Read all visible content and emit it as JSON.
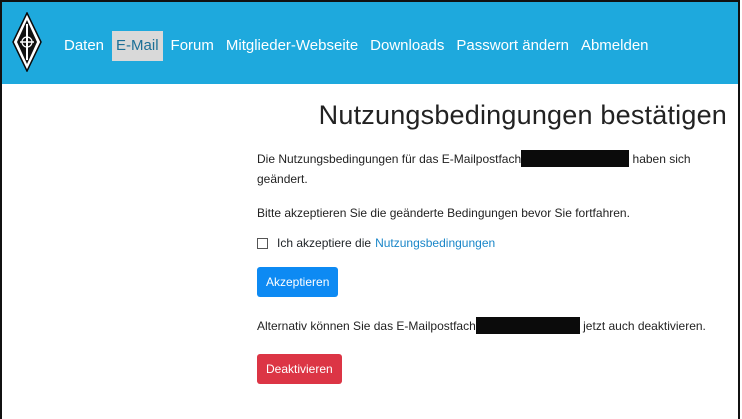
{
  "nav": {
    "items": [
      {
        "label": "Daten",
        "active": false
      },
      {
        "label": "E-Mail",
        "active": true
      },
      {
        "label": "Forum",
        "active": false
      },
      {
        "label": "Mitglieder-Webseite",
        "active": false
      },
      {
        "label": "Downloads",
        "active": false
      },
      {
        "label": "Passwort ändern",
        "active": false
      },
      {
        "label": "Abmelden",
        "active": false
      }
    ]
  },
  "colors": {
    "navbar_bg": "#1ea9dd",
    "active_bg": "#d9d9d9",
    "primary_button": "#0d8af3",
    "danger_button": "#dc3545",
    "link": "#1a86c8"
  },
  "main": {
    "title": "Nutzungsbedingungen bestätigen",
    "intro_before": "Die Nutzungsbedingungen für das E-Mailpostfach",
    "intro_after": "haben sich geändert.",
    "instruction": "Bitte akzeptieren Sie die geänderte Bedingungen bevor Sie fortfahren.",
    "checkbox_label": "Ich akzeptiere die",
    "checkbox_link": "Nutzungsbedingungen",
    "checkbox_checked": false,
    "accept_button": "Akzeptieren",
    "alt_before": "Alternativ können Sie das E-Mailpostfach",
    "alt_after": "jetzt auch deaktivieren.",
    "deactivate_button": "Deaktivieren"
  }
}
